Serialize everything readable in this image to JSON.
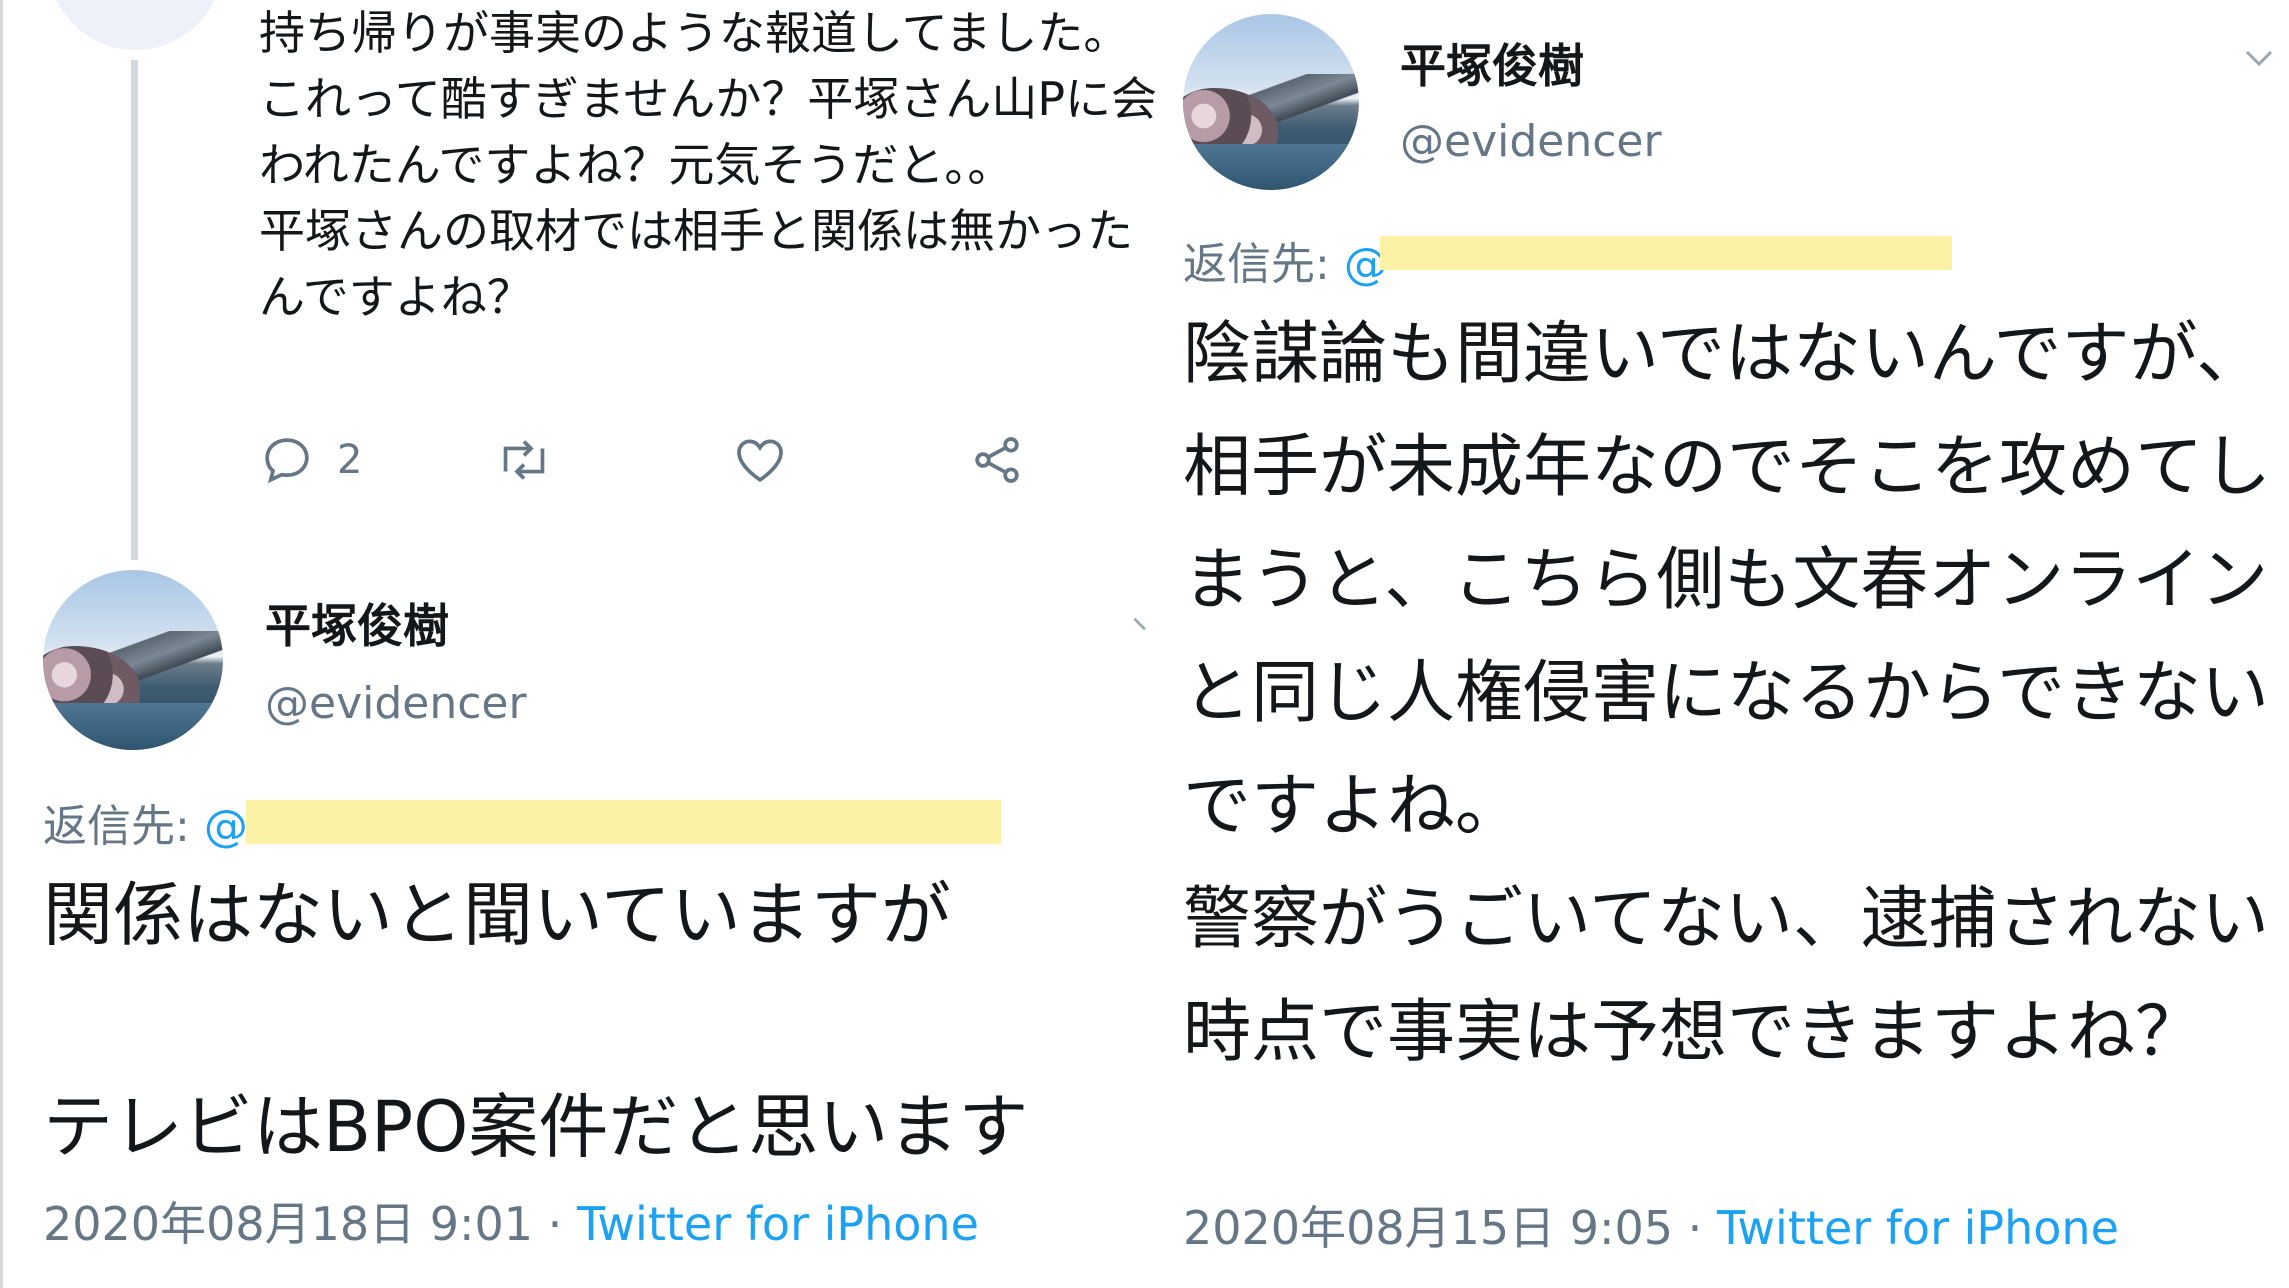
{
  "left": {
    "prev_tweet": {
      "text": "持ち帰りが事実のような報道してました。これって酷すぎませんか？平塚さん山Pに会われたんですよね？元気そうだと。。\n平塚さんの取材では相手と関係は無かったんですよね？",
      "reply_count": "2"
    },
    "tweet": {
      "name": "平塚俊樹",
      "handle": "@evidencer",
      "reply_label": "返信先: ",
      "reply_at": "@",
      "text": "関係はないと聞いていますが\n\nテレビはBPO案件だと思います",
      "date": "2020年08月18日 9:01",
      "separator": " · ",
      "source": "Twitter for iPhone"
    }
  },
  "right": {
    "tweet": {
      "name": "平塚俊樹",
      "handle": "@evidencer",
      "reply_label": "返信先: ",
      "reply_at": "@",
      "text": "陰謀論も間違いではないんですが、相手が未成年なのでそこを攻めてしまうと、こちら側も文春オンラインと同じ人権侵害になるからできないですよね。\n警察がうごいてない、逮捕されない時点で事実は予想できますよね？",
      "date": "2020年08月15日 9:05",
      "separator": " · ",
      "source": "Twitter for iPhone"
    }
  },
  "colors": {
    "accent": "#1da1f2",
    "secondary_text": "#657786",
    "redaction": "#fbf2a5"
  },
  "icons": [
    "reply-icon",
    "retweet-icon",
    "like-icon",
    "share-icon",
    "chevron-down-icon"
  ]
}
